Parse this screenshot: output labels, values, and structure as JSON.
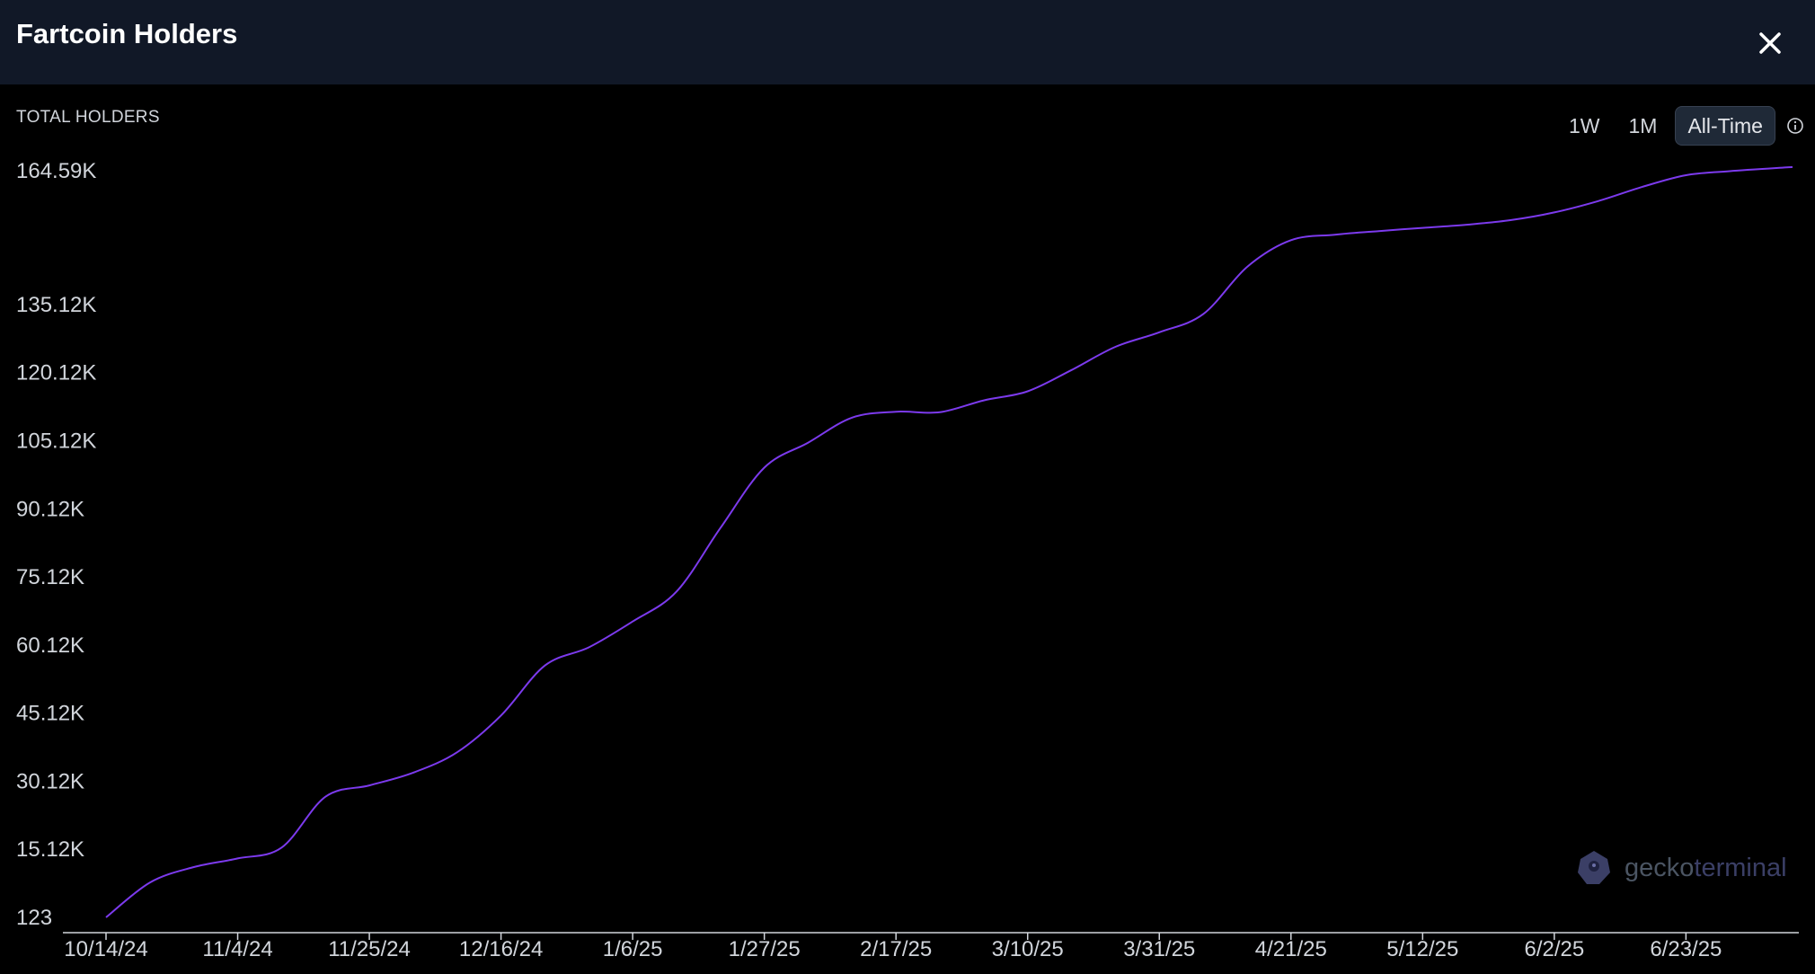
{
  "header": {
    "title": "Fartcoin Holders"
  },
  "metric_label": "TOTAL HOLDERS",
  "range_tabs": [
    {
      "label": "1W",
      "active": false
    },
    {
      "label": "1M",
      "active": false
    },
    {
      "label": "All-Time",
      "active": true
    }
  ],
  "icons": {
    "close": "close-icon",
    "info": "info-icon",
    "brand": "gecko-logo-icon"
  },
  "watermark": {
    "brand_a": "gecko",
    "brand_b": "terminal"
  },
  "colors": {
    "line": "#7c3aed",
    "header_bg": "#111827",
    "background": "#000000"
  },
  "chart_data": {
    "type": "line",
    "title": "",
    "xlabel": "",
    "ylabel": "TOTAL HOLDERS",
    "grid": false,
    "y_tick_labels": [
      "123",
      "15.12K",
      "30.12K",
      "45.12K",
      "60.12K",
      "75.12K",
      "90.12K",
      "105.12K",
      "120.12K",
      "135.12K",
      "164.59K"
    ],
    "y_tick_values": [
      123,
      15120,
      30120,
      45120,
      60120,
      75120,
      90120,
      105120,
      120120,
      135120,
      164590
    ],
    "ylim": [
      123,
      164590
    ],
    "x_tick_labels": [
      "10/14/24",
      "11/4/24",
      "11/25/24",
      "12/16/24",
      "1/6/25",
      "1/27/25",
      "2/17/25",
      "3/10/25",
      "3/31/25",
      "4/21/25",
      "5/12/25",
      "6/2/25",
      "6/23/25"
    ],
    "xlim": [
      "2024-10-14",
      "2025-07-10"
    ],
    "series": [
      {
        "name": "",
        "points": [
          [
            "2024-10-14",
            123
          ],
          [
            "2024-10-21",
            7800
          ],
          [
            "2024-10-28",
            11200
          ],
          [
            "2024-11-04",
            13100
          ],
          [
            "2024-11-11",
            15500
          ],
          [
            "2024-11-18",
            26700
          ],
          [
            "2024-11-25",
            29200
          ],
          [
            "2024-12-02",
            32000
          ],
          [
            "2024-12-09",
            36500
          ],
          [
            "2024-12-16",
            44600
          ],
          [
            "2024-12-23",
            55600
          ],
          [
            "2024-12-30",
            59600
          ],
          [
            "2025-01-06",
            65300
          ],
          [
            "2025-01-13",
            71900
          ],
          [
            "2025-01-20",
            85900
          ],
          [
            "2025-01-27",
            99200
          ],
          [
            "2025-02-03",
            104700
          ],
          [
            "2025-02-10",
            110200
          ],
          [
            "2025-02-17",
            111500
          ],
          [
            "2025-02-24",
            111400
          ],
          [
            "2025-03-03",
            114000
          ],
          [
            "2025-03-10",
            116000
          ],
          [
            "2025-03-17",
            120700
          ],
          [
            "2025-03-24",
            125800
          ],
          [
            "2025-03-31",
            129000
          ],
          [
            "2025-04-07",
            133000
          ],
          [
            "2025-04-14",
            143400
          ],
          [
            "2025-04-21",
            149300
          ],
          [
            "2025-04-28",
            150500
          ],
          [
            "2025-05-05",
            151300
          ],
          [
            "2025-05-12",
            152000
          ],
          [
            "2025-05-19",
            152700
          ],
          [
            "2025-05-26",
            153700
          ],
          [
            "2025-06-02",
            155400
          ],
          [
            "2025-06-09",
            157900
          ],
          [
            "2025-06-16",
            161000
          ],
          [
            "2025-06-23",
            163600
          ],
          [
            "2025-06-30",
            164500
          ],
          [
            "2025-07-10",
            165400
          ]
        ]
      }
    ]
  }
}
